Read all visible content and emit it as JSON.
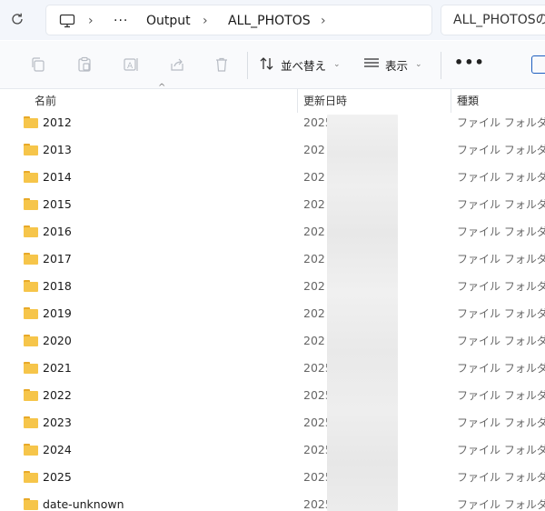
{
  "address_bar": {
    "refresh_icon": "refresh-icon",
    "breadcrumb": {
      "pc_icon": "this-pc-icon",
      "overflow": "···",
      "items": [
        "Output",
        "ALL_PHOTOS"
      ]
    },
    "search_placeholder": "ALL_PHOTOSの検索"
  },
  "toolbar": {
    "buttons": [
      "copy-icon",
      "paste-icon",
      "rename-icon",
      "share-icon",
      "delete-icon"
    ],
    "sort_label": "並べ替え",
    "view_label": "表示",
    "more": "•••"
  },
  "columns": {
    "name": "名前",
    "date": "更新日時",
    "type": "種類"
  },
  "rows": [
    {
      "name": "2012",
      "date": "2025",
      "type": "ファイル フォルダー"
    },
    {
      "name": "2013",
      "date": "202",
      "type": "ファイル フォルダー"
    },
    {
      "name": "2014",
      "date": "202",
      "type": "ファイル フォルダー"
    },
    {
      "name": "2015",
      "date": "202",
      "type": "ファイル フォルダー"
    },
    {
      "name": "2016",
      "date": "202",
      "type": "ファイル フォルダー"
    },
    {
      "name": "2017",
      "date": "202",
      "type": "ファイル フォルダー"
    },
    {
      "name": "2018",
      "date": "202",
      "type": "ファイル フォルダー"
    },
    {
      "name": "2019",
      "date": "202",
      "type": "ファイル フォルダー"
    },
    {
      "name": "2020",
      "date": "202",
      "type": "ファイル フォルダー"
    },
    {
      "name": "2021",
      "date": "2025",
      "type": "ファイル フォルダー"
    },
    {
      "name": "2022",
      "date": "2025,",
      "type": "ファイル フォルダー"
    },
    {
      "name": "2023",
      "date": "2025/",
      "type": "ファイル フォルダー"
    },
    {
      "name": "2024",
      "date": "2025/",
      "type": "ファイル フォルダー"
    },
    {
      "name": "2025",
      "date": "2025/",
      "type": "ファイル フォルダー"
    },
    {
      "name": "date-unknown",
      "date": "2025/",
      "type": "ファイル フォルダー"
    }
  ]
}
